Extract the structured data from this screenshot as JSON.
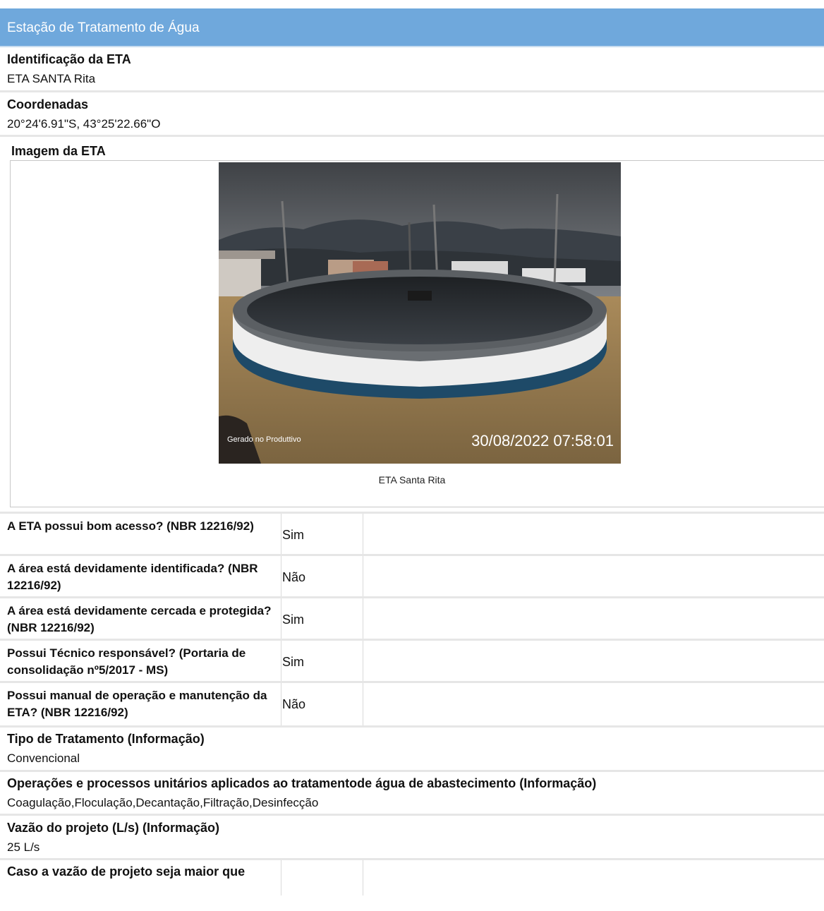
{
  "header": {
    "title": "Estação de Tratamento de Água"
  },
  "identificacao": {
    "label": "Identificação da ETA",
    "value": "ETA SANTA Rita"
  },
  "coordenadas": {
    "label": "Coordenadas",
    "value": "20°24'6.91\"S, 43°25'22.66\"O"
  },
  "imagem": {
    "label": "Imagem da ETA",
    "caption": "ETA Santa Rita",
    "photo_watermark": "Gerado no Produttivo",
    "photo_timestamp": "30/08/2022 07:58:01"
  },
  "questions": [
    {
      "question": "A ETA possui bom acesso? (NBR 12216/92)",
      "answer": "Sim"
    },
    {
      "question": "A área está devidamente identificada? (NBR 12216/92)",
      "answer": "Não"
    },
    {
      "question": "A área está devidamente cercada e protegida? (NBR 12216/92)",
      "answer": "Sim"
    },
    {
      "question": "Possui Técnico responsável? (Portaria de consolidação nº5/2017 - MS)",
      "answer": "Sim"
    },
    {
      "question": "Possui manual de operação e manutenção da ETA? (NBR 12216/92)",
      "answer": "Não"
    }
  ],
  "tipo_tratamento": {
    "label": "Tipo de Tratamento (Informação)",
    "value": "Convencional"
  },
  "operacoes": {
    "label": "Operações e processos unitários aplicados ao tratamentode água de abastecimento (Informação)",
    "value": "Coagulação,Floculação,Decantação,Filtração,Desinfecção"
  },
  "vazao": {
    "label": "Vazão do projeto (L/s) (Informação)",
    "value": "25 L/s"
  },
  "partial_question": {
    "question": "Caso a vazão de projeto seja maior que"
  }
}
